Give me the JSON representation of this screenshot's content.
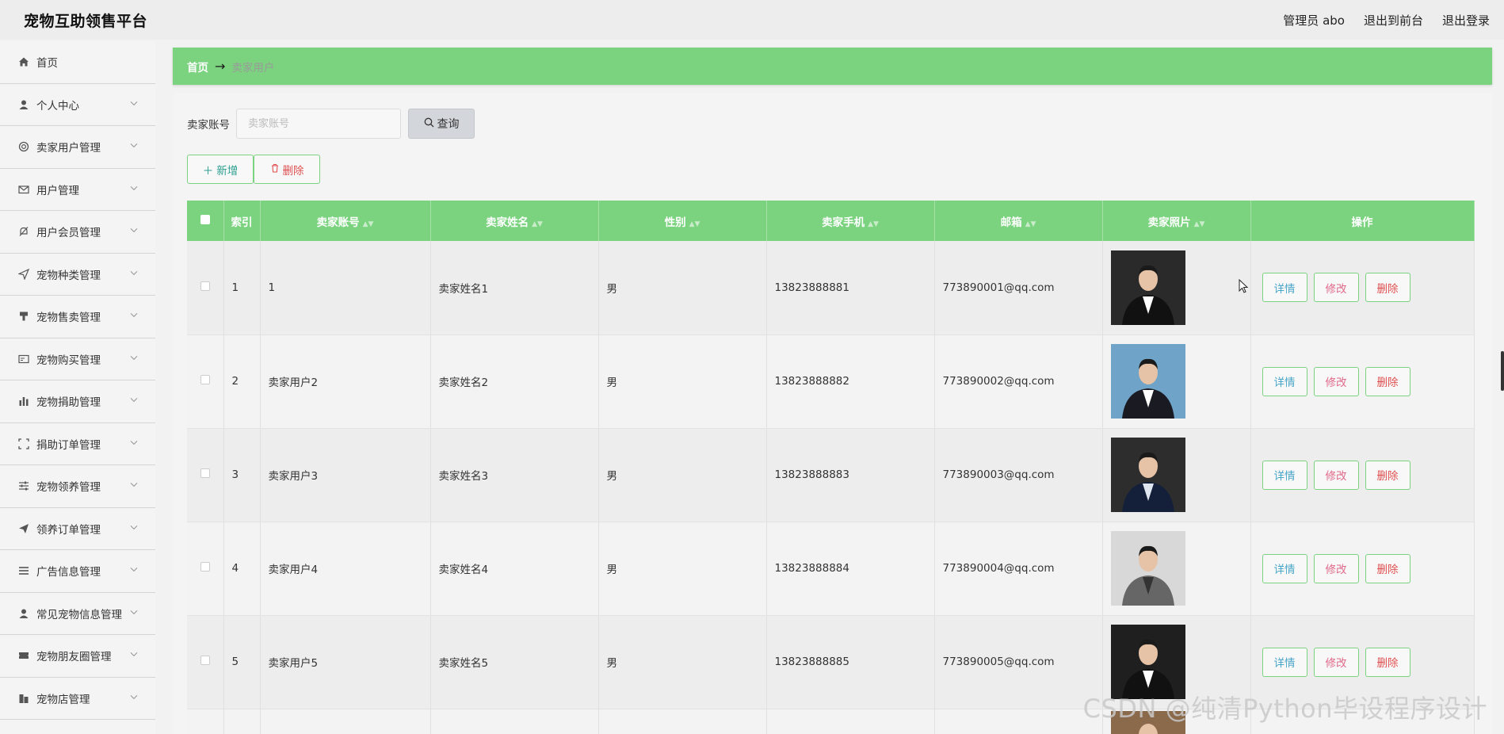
{
  "brand": "宠物互助领售平台",
  "top_nav": {
    "admin": "管理员 abo",
    "to_front": "退出到前台",
    "logout": "退出登录"
  },
  "sidebar": {
    "items": [
      {
        "label": "首页",
        "icon": "home-icon"
      },
      {
        "label": "个人中心",
        "icon": "user-icon"
      },
      {
        "label": "卖家用户管理",
        "icon": "lifebuoy-icon"
      },
      {
        "label": "用户管理",
        "icon": "mail-icon"
      },
      {
        "label": "用户会员管理",
        "icon": "bell-off-icon"
      },
      {
        "label": "宠物种类管理",
        "icon": "send-icon"
      },
      {
        "label": "宠物售卖管理",
        "icon": "brush-icon"
      },
      {
        "label": "宠物购买管理",
        "icon": "card-icon"
      },
      {
        "label": "宠物捐助管理",
        "icon": "bar-chart-icon"
      },
      {
        "label": "捐助订单管理",
        "icon": "fullscreen-icon"
      },
      {
        "label": "宠物领养管理",
        "icon": "sliders-icon"
      },
      {
        "label": "领养订单管理",
        "icon": "paper-plane-icon"
      },
      {
        "label": "广告信息管理",
        "icon": "menu-icon"
      },
      {
        "label": "常见宠物信息管理",
        "icon": "person-icon"
      },
      {
        "label": "宠物朋友圈管理",
        "icon": "ticket-icon"
      },
      {
        "label": "宠物店管理",
        "icon": "building-icon"
      }
    ]
  },
  "breadcrumb": {
    "home": "首页",
    "current": "卖家用户"
  },
  "search": {
    "label": "卖家账号",
    "placeholder": "卖家账号",
    "button": "查询"
  },
  "actions": {
    "add": "新增",
    "delete": "删除"
  },
  "table": {
    "columns": [
      "索引",
      "卖家账号",
      "卖家姓名",
      "性别",
      "卖家手机",
      "邮箱",
      "卖家照片",
      "操作"
    ],
    "rows": [
      {
        "index": "1",
        "account": "1",
        "name": "卖家姓名1",
        "gender": "男",
        "phone": "13823888881",
        "email": "773890001@qq.com"
      },
      {
        "index": "2",
        "account": "卖家用户2",
        "name": "卖家姓名2",
        "gender": "男",
        "phone": "13823888882",
        "email": "773890002@qq.com"
      },
      {
        "index": "3",
        "account": "卖家用户3",
        "name": "卖家姓名3",
        "gender": "男",
        "phone": "13823888883",
        "email": "773890003@qq.com"
      },
      {
        "index": "4",
        "account": "卖家用户4",
        "name": "卖家姓名4",
        "gender": "男",
        "phone": "13823888884",
        "email": "773890004@qq.com"
      },
      {
        "index": "5",
        "account": "卖家用户5",
        "name": "卖家姓名5",
        "gender": "男",
        "phone": "13823888885",
        "email": "773890005@qq.com"
      }
    ],
    "op_labels": {
      "detail": "详情",
      "edit": "修改",
      "delete": "删除"
    }
  },
  "watermark": "CSDN @纯清Python毕设程序设计",
  "colors": {
    "accent": "#7bd37f",
    "detail": "#4aa6c9",
    "edit": "#e06a8a",
    "danger": "#e05050"
  }
}
